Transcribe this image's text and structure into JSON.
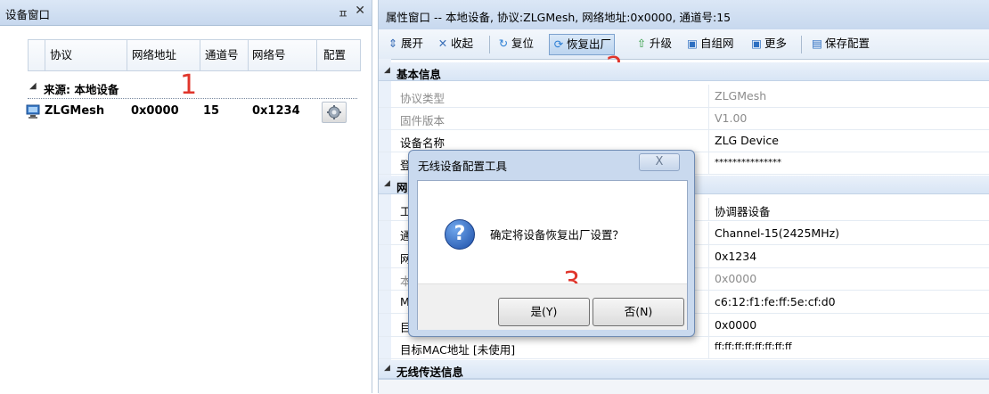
{
  "left_panel": {
    "title": "设备窗口",
    "pin_glyph": "ㅍ",
    "close_glyph": "✕",
    "columns": [
      "协议",
      "网络地址",
      "通道号",
      "网络号",
      "配置"
    ],
    "group": {
      "arrow": "◢",
      "label": "来源: 本地设备"
    },
    "devices": [
      {
        "protocol": "ZLGMesh",
        "address": "0x0000",
        "channel": "15",
        "network": "0x1234"
      }
    ],
    "annotation": "1"
  },
  "right_panel": {
    "title": "属性窗口 -- 本地设备, 协议:ZLGMesh, 网络地址:0x0000, 通道号:15",
    "toolbar": [
      {
        "label": "展开",
        "icon": "expand-icon"
      },
      {
        "label": "收起",
        "icon": "collapse-icon"
      },
      {
        "label": "复位",
        "icon": "reset-icon"
      },
      {
        "label": "恢复出厂",
        "icon": "factory-reset-icon",
        "pressed": true
      },
      {
        "label": "升级",
        "icon": "upgrade-icon"
      },
      {
        "label": "自组网",
        "icon": "mesh-icon"
      },
      {
        "label": "更多",
        "icon": "more-icon"
      },
      {
        "label": "保存配置",
        "icon": "save-icon"
      }
    ],
    "annotation": "2",
    "sections": [
      {
        "title": "基本信息",
        "rows": [
          {
            "key": "协议类型",
            "value": "ZLGMesh",
            "readonly": true
          },
          {
            "key": "固件版本",
            "value": "V1.00",
            "readonly": true
          },
          {
            "key": "设备名称",
            "value": "ZLG Device",
            "readonly": false
          },
          {
            "key": "登",
            "value": "***************",
            "readonly": false
          }
        ]
      },
      {
        "title": "网",
        "rows": [
          {
            "key": "工",
            "value": "协调器设备",
            "readonly": false
          },
          {
            "key": "通",
            "value": "Channel-15(2425MHz)",
            "readonly": false
          },
          {
            "key": "网",
            "value": "0x1234",
            "readonly": false
          },
          {
            "key": "本",
            "value": "0x0000",
            "readonly": true
          },
          {
            "key": "M",
            "value": "c6:12:f1:fe:ff:5e:cf:d0",
            "readonly": false
          },
          {
            "key": "目",
            "value": "0x0000",
            "readonly": false
          },
          {
            "key": "目标MAC地址 [未使用]",
            "value": "ff:ff:ff:ff:ff:ff:ff:ff",
            "readonly": false
          }
        ]
      },
      {
        "title": "无线传送信息",
        "rows": []
      }
    ]
  },
  "dialog": {
    "title": "无线设备配置工具",
    "close_glyph": "X",
    "icon_glyph": "?",
    "message": "确定将设备恢复出厂设置？",
    "yes_label": "是(Y)",
    "no_label": "否(N)",
    "annotation": "3"
  },
  "colors": {
    "annotation_red": "#e0352b",
    "title_bar": "#c7d8ee",
    "accent_blue": "#1d4fa8"
  }
}
